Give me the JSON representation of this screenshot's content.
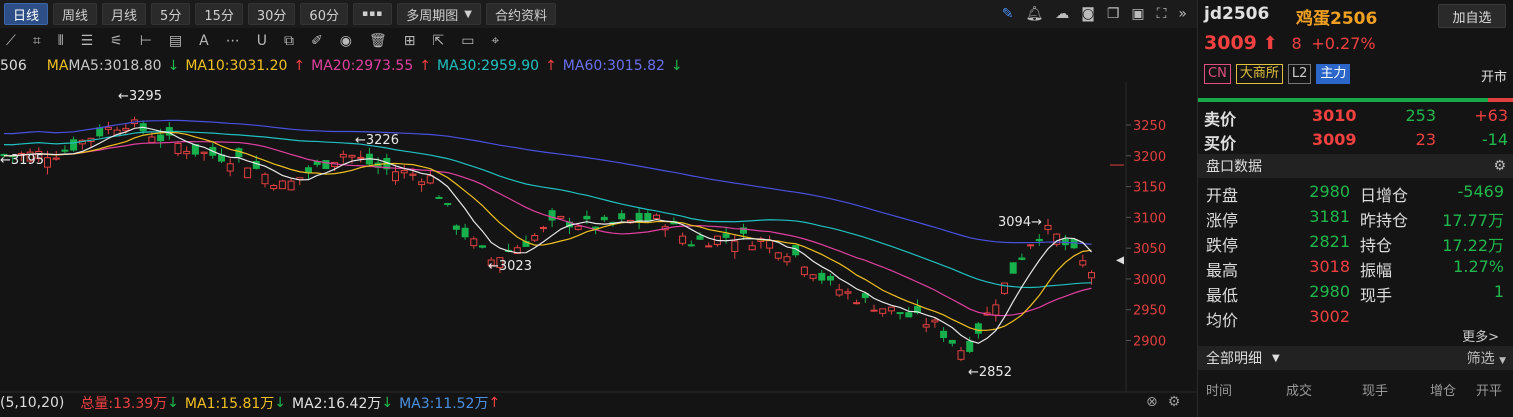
{
  "toolbar": {
    "periods": [
      "日线",
      "周线",
      "月线",
      "5分",
      "15分",
      "30分",
      "60分"
    ],
    "more": "▪▪▪",
    "multi": "多周期图",
    "contract": "合约资料"
  },
  "ma": {
    "prefix": "506",
    "label": "MA",
    "ma5": "MA5:3018.80",
    "ma10": "MA10:3031.20",
    "ma20": "MA20:2973.55",
    "ma30": "MA30:2959.90",
    "ma60": "MA60:3015.82",
    "colors": {
      "ma5": "#e8e8e8",
      "ma10": "#f0c020",
      "ma20": "#e040a0",
      "ma30": "#20c0c0",
      "ma60": "#4a50e0"
    }
  },
  "volume": {
    "params": "(5,10,20)",
    "total": "总量:13.39万",
    "ma1": "MA1:15.81万",
    "ma2": "MA2:16.42万",
    "ma3": "MA3:11.52万"
  },
  "chart_data": {
    "type": "candlestick",
    "y_ticks": [
      3250,
      3200,
      3150,
      3100,
      3050,
      3000,
      2950,
      2900
    ],
    "ylim": [
      2850,
      3300
    ],
    "annotations": [
      {
        "label": "←3295",
        "value": 3295
      },
      {
        "label": "←3226",
        "value": 3226
      },
      {
        "label": "←3195",
        "value": 3195
      },
      {
        "label": "←3023",
        "value": 3023
      },
      {
        "label": "3094→",
        "value": 3094
      },
      {
        "label": "←2852",
        "value": 2852
      }
    ],
    "last_marker": 3009
  },
  "panel": {
    "code": "jd2506",
    "name": "鸡蛋2506",
    "add": "加自选",
    "price": "3009",
    "up_arrow": "⬆",
    "change": "8",
    "pct": "+0.27%",
    "tags": {
      "cn": "CN",
      "exchange": "大商所",
      "l2": "L2",
      "main": "主力"
    },
    "status": "开市",
    "ask": {
      "label": "卖价",
      "price": "3010",
      "vol": "253",
      "chg": "+63"
    },
    "bid": {
      "label": "买价",
      "price": "3009",
      "vol": "23",
      "chg": "-14"
    },
    "section1": "盘口数据",
    "rows": [
      {
        "l1": "开盘",
        "v1": "2980",
        "l2": "日增仓",
        "v2": "-5469"
      },
      {
        "l1": "涨停",
        "v1": "3181",
        "l2": "昨持仓",
        "v2": "17.77万"
      },
      {
        "l1": "跌停",
        "v1": "2821",
        "l2": "持仓",
        "v2": "17.22万"
      },
      {
        "l1": "最高",
        "v1": "3018",
        "l2": "振幅",
        "v2": "1.27%"
      },
      {
        "l1": "最低",
        "v1": "2980",
        "l2": "现手",
        "v2": "1"
      },
      {
        "l1": "均价",
        "v1": "3002",
        "l2": "",
        "v2": ""
      }
    ],
    "more": "更多>",
    "section2": "全部明细",
    "filter": "筛选",
    "table_headers": [
      "时间",
      "成交",
      "现手",
      "增仓",
      "开平"
    ]
  }
}
